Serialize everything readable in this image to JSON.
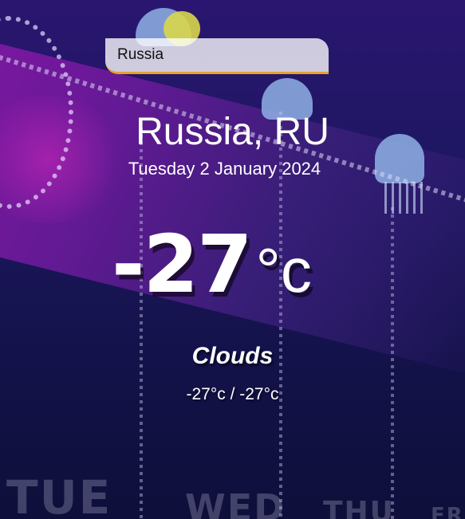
{
  "search": {
    "value": "Russia",
    "placeholder": ""
  },
  "location": {
    "name": "Russia, RU"
  },
  "date": "Tuesday 2 January 2024",
  "current": {
    "temperature": "-27",
    "unit": "°c"
  },
  "condition": "Clouds",
  "min_max": "-27°c / -27°c",
  "background": {
    "days": [
      "TUE",
      "WED",
      "THU",
      "FRI"
    ]
  },
  "colors": {
    "search_underline": "#e8a02c",
    "text": "#ffffff",
    "background_top": "#2a1670",
    "background_bottom": "#0e0f3a"
  }
}
